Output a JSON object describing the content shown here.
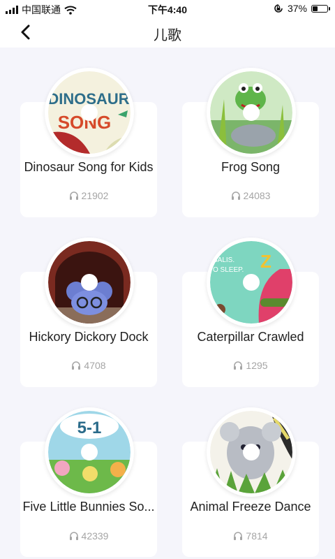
{
  "status_bar": {
    "carrier": "中国联通",
    "time": "下午4:40",
    "battery_percent_text": "37%",
    "battery_level": 0.37,
    "icons": [
      "signal-icon",
      "wifi-icon",
      "orientation-lock-icon",
      "battery-icon"
    ]
  },
  "nav": {
    "title": "儿歌",
    "back_icon": "chevron-left-icon"
  },
  "songs": [
    {
      "title": "Dinosaur Song for Kids",
      "plays": "21902",
      "disc_art": "DINOSAUR SONG"
    },
    {
      "title": "Frog Song",
      "plays": "24083",
      "disc_art": ""
    },
    {
      "title": "Hickory Dickory Dock",
      "plays": "4708",
      "disc_art": ""
    },
    {
      "title": "Caterpillar Crawled",
      "plays": "1295",
      "disc_art": "SALIS. O SLEEP. Z"
    },
    {
      "title": "Five Little Bunnies So...",
      "plays": "42339",
      "disc_art": "5-1"
    },
    {
      "title": "Animal Freeze Dance",
      "plays": "7814",
      "disc_art": ""
    }
  ],
  "colors": {
    "background": "#f5f5fb",
    "card": "#ffffff",
    "play_count": "#a5a5a5"
  }
}
